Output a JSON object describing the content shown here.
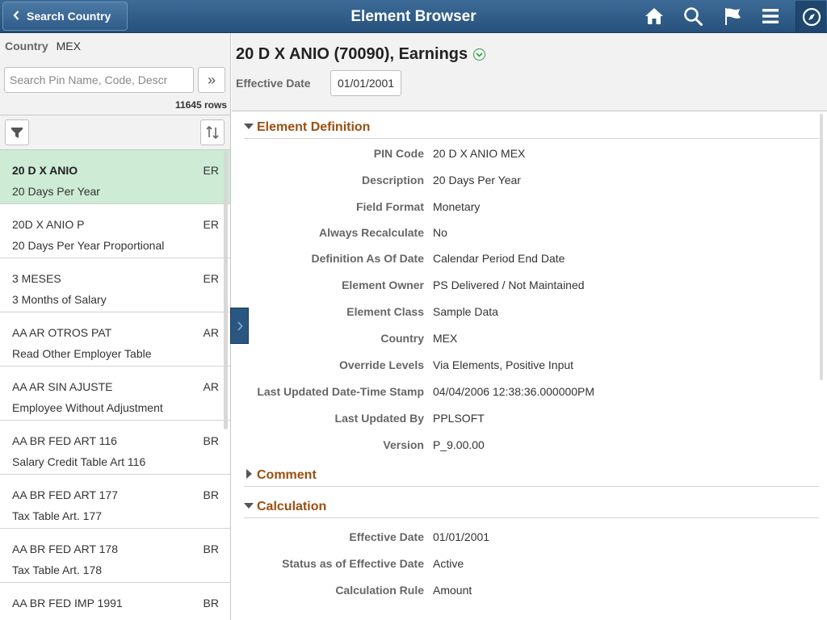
{
  "header": {
    "back_label": "Search Country",
    "title": "Element Browser",
    "icons": [
      "home-icon",
      "search-icon",
      "flag-icon",
      "menu-icon",
      "navbar-compass-icon"
    ]
  },
  "left": {
    "country_label": "Country",
    "country_value": "MEX",
    "search_placeholder": "Search Pin Name, Code, Descr",
    "search_go": "»",
    "row_count": "11645 rows",
    "items": [
      {
        "code": "20 D X ANIO",
        "desc": "20 Days Per Year",
        "type": "ER"
      },
      {
        "code": "20D X ANIO P",
        "desc": "20 Days Per Year Proportional",
        "type": "ER"
      },
      {
        "code": "3 MESES",
        "desc": "3 Months of Salary",
        "type": "ER"
      },
      {
        "code": "AA AR OTROS PAT",
        "desc": "Read Other Employer Table",
        "type": "AR"
      },
      {
        "code": "AA AR SIN AJUSTE",
        "desc": "Employee Without Adjustment",
        "type": "AR"
      },
      {
        "code": "AA BR FED ART 116",
        "desc": "Salary Credit Table Art 116",
        "type": "BR"
      },
      {
        "code": "AA BR FED ART 177",
        "desc": "Tax Table Art. 177",
        "type": "BR"
      },
      {
        "code": "AA BR FED ART 178",
        "desc": "Tax Table Art. 178",
        "type": "BR"
      },
      {
        "code": "AA BR FED IMP 1991",
        "desc": "",
        "type": "BR"
      }
    ]
  },
  "right": {
    "title": "20 D X ANIO (70090), Earnings",
    "effective_date_label": "Effective Date",
    "effective_date_value": "01/01/2001",
    "sections": {
      "element_definition": {
        "title": "Element Definition",
        "fields": [
          {
            "label": "PIN Code",
            "value": "20 D X ANIO MEX"
          },
          {
            "label": "Description",
            "value": "20 Days Per Year"
          },
          {
            "label": "Field Format",
            "value": "Monetary"
          },
          {
            "label": "Always Recalculate",
            "value": "No"
          },
          {
            "label": "Definition As Of Date",
            "value": "Calendar Period End Date"
          },
          {
            "label": "Element Owner",
            "value": "PS Delivered / Not Maintained"
          },
          {
            "label": "Element Class",
            "value": "Sample Data"
          },
          {
            "label": "Country",
            "value": "MEX"
          },
          {
            "label": "Override Levels",
            "value": "Via Elements, Positive Input"
          },
          {
            "label": "Last Updated Date-Time Stamp",
            "value": "04/04/2006 12:38:36.000000PM"
          },
          {
            "label": "Last Updated By",
            "value": "PPLSOFT"
          },
          {
            "label": "Version",
            "value": "P_9.00.00"
          }
        ]
      },
      "comment": {
        "title": "Comment"
      },
      "calculation": {
        "title": "Calculation",
        "fields": [
          {
            "label": "Effective Date",
            "value": "01/01/2001"
          },
          {
            "label": "Status as of Effective Date",
            "value": "Active"
          },
          {
            "label": "Calculation Rule",
            "value": "Amount"
          }
        ]
      }
    }
  },
  "colors": {
    "header": "#26517c",
    "section_title": "#9b4f0f",
    "selected_row": "#cdebd5"
  }
}
